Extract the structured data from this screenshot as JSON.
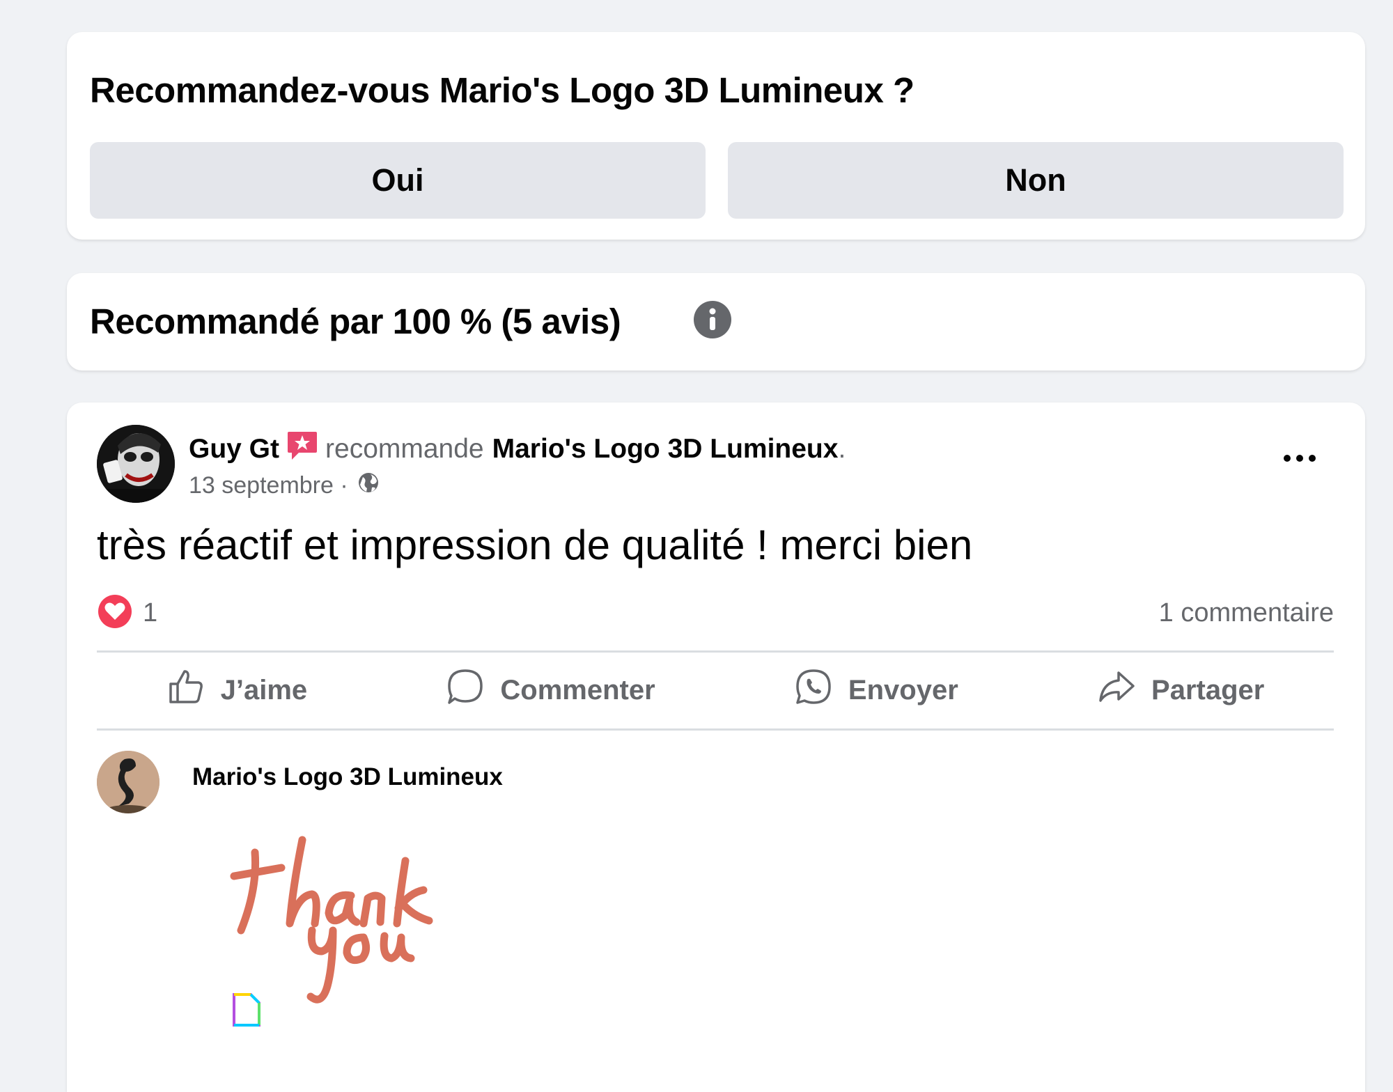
{
  "question_card": {
    "title": "Recommandez-vous Mario's Logo 3D Lumineux ?",
    "yes_label": "Oui",
    "no_label": "Non"
  },
  "summary_card": {
    "title": "Recommandé par 100 % (5 avis)",
    "info_icon": "info-icon"
  },
  "post": {
    "author": "Guy Gt",
    "badge_icon": "top-fan-badge-icon",
    "recommends_text": "recommande",
    "page_name": "Mario's Logo 3D Lumineux",
    "period": ".",
    "date": "13 septembre ·",
    "privacy_icon": "globe-icon",
    "body": "très réactif et impression de qualité ! merci bien",
    "reaction_count": "1",
    "comment_count": "1 commentaire",
    "actions": {
      "like": "J’aime",
      "comment": "Commenter",
      "send": "Envoyer",
      "share": "Partager"
    }
  },
  "comment": {
    "author": "Mario's Logo 3D Lumineux",
    "sticker": "thank you"
  },
  "colors": {
    "background": "#f0f2f5",
    "card": "#ffffff",
    "button": "#e4e6eb",
    "secondary_text": "#65676b",
    "love_red": "#f33e58",
    "sticker_orange": "#d9705a"
  }
}
